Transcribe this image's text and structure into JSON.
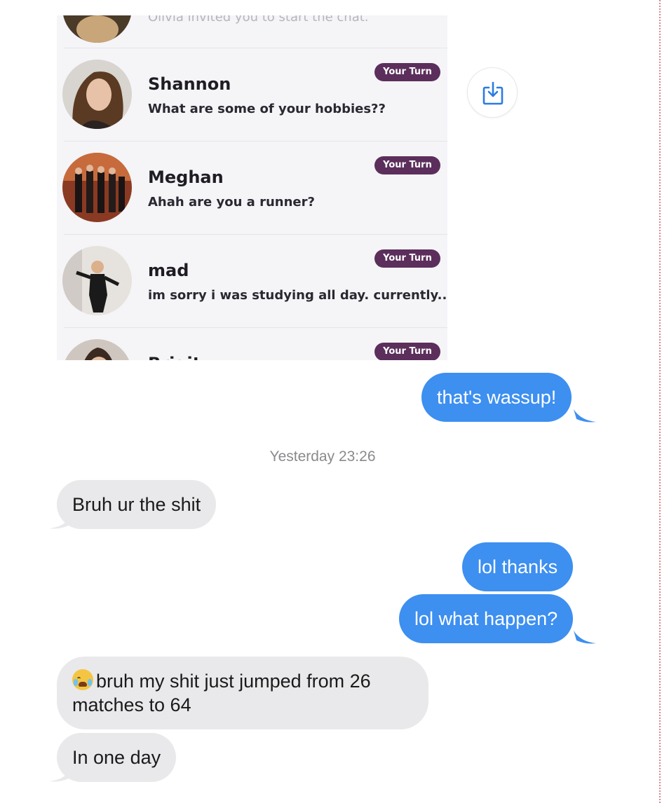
{
  "embedded_app": {
    "top_partial_text": "Olivia invited you to start the chat.",
    "matches": [
      {
        "name": "Shannon",
        "message": "What are some of your hobbies??",
        "badge": "Your Turn"
      },
      {
        "name": "Meghan",
        "message": "Ahah are you a runner?",
        "badge": "Your Turn"
      },
      {
        "name": "mad",
        "message": "im sorry i was studying all day. currently...",
        "badge": "Your Turn"
      },
      {
        "name": "Brigit",
        "message": "",
        "badge": "Your Turn"
      }
    ]
  },
  "share_icon": "share-download-icon",
  "messages": [
    {
      "direction": "outgoing",
      "text": "that's wassup!"
    },
    {
      "direction": "incoming",
      "text": "Bruh ur the shit"
    },
    {
      "direction": "outgoing",
      "text": "lol thanks"
    },
    {
      "direction": "outgoing",
      "text": "lol what happen?"
    },
    {
      "direction": "incoming",
      "emoji": "loudly-crying-face",
      "line1": "bruh my shit just jumped from 26",
      "line2": "matches to 64"
    },
    {
      "direction": "incoming",
      "text": "In one day"
    }
  ],
  "timestamp": "Yesterday 23:26",
  "colors": {
    "outgoing_bubble": "#3d8ff0",
    "incoming_bubble": "#e9e9eb",
    "badge": "#5b2e5c",
    "embedded_bg": "#f5f4f7"
  }
}
